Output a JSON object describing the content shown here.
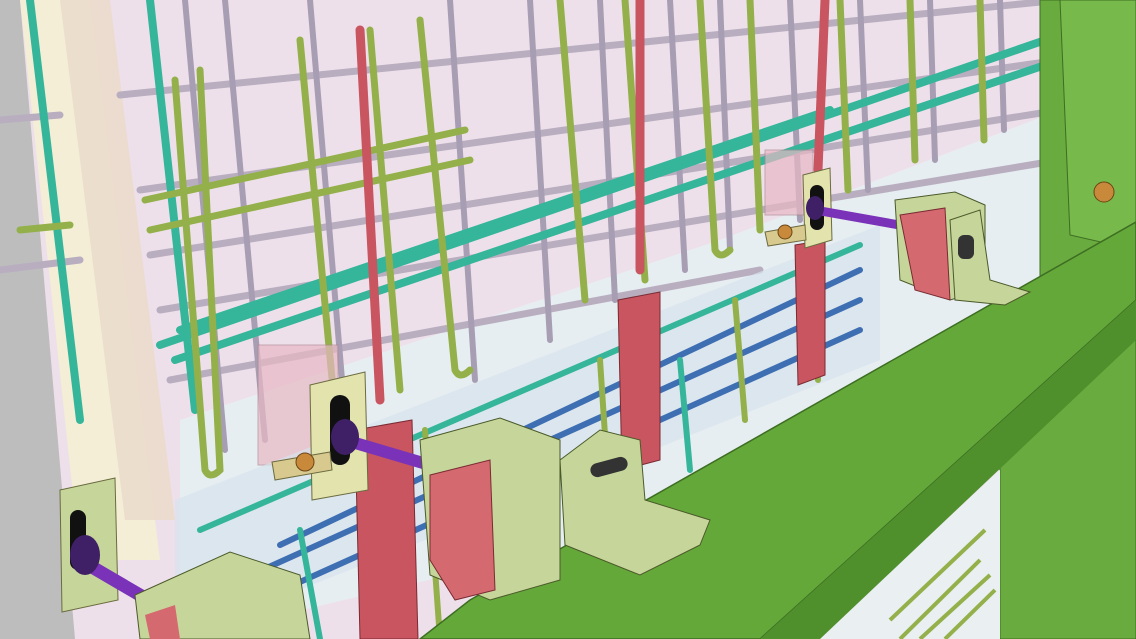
{
  "scene": {
    "kind": "3d-model-render",
    "subject": "precast-panel-connection",
    "colors": {
      "background_wall": "#eee0ea",
      "panel_edge": "#f2ead4",
      "steel_beam_top": "#65a83a",
      "steel_beam_face": "#4f8f2c",
      "steel_column": "#6aab3f",
      "bracket": "#c6d69a",
      "bracket_pad": "#d46a70",
      "embed_plate": "#e3e3ae",
      "anchor_rod": "#7a33b8",
      "nut": "#3f1f66",
      "sleeve": "#e8b8c4",
      "red_dowel": "#c95560",
      "rebar_grey": "#c0b6c5",
      "rebar_green": "#93b04a",
      "rebar_teal": "#35b59a",
      "rebar_blue": "#3f6fb3",
      "grey_wall": "#bdbdbd"
    }
  }
}
